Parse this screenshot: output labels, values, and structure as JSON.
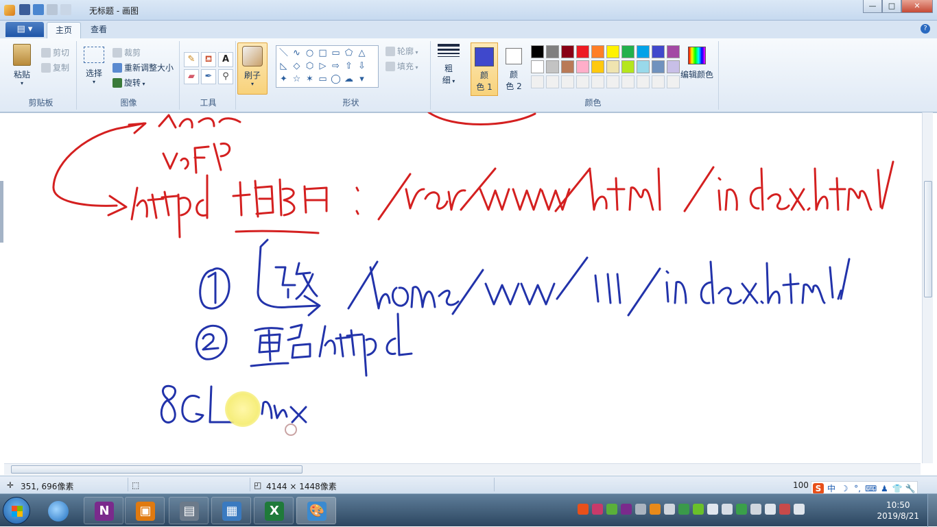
{
  "window": {
    "title": "无标题 - 画图",
    "controls": {
      "minimize": "—",
      "maximize": "□",
      "close": "✕"
    }
  },
  "tabs": {
    "app_menu": "▤ ▾",
    "home": "主页",
    "view": "查看",
    "help": "?"
  },
  "ribbon": {
    "clipboard": {
      "label": "剪贴板",
      "paste": "粘贴",
      "cut": "剪切",
      "copy": "复制"
    },
    "image": {
      "label": "图像",
      "select": "选择",
      "crop": "裁剪",
      "resize": "重新调整大小",
      "rotate": "旋转"
    },
    "tools": {
      "label": "工具",
      "text_tool": "A"
    },
    "brushes": {
      "label": "刷子"
    },
    "shapes": {
      "label": "形状",
      "glyphs": [
        "＼",
        "∿",
        "○",
        "□",
        "▭",
        "⬠",
        "△",
        "◺",
        "◇",
        "⬡",
        "▷",
        "⇨",
        "⇧",
        "⇩",
        "✦",
        "☆",
        "✶",
        "▭",
        "◯",
        "☁",
        "▾"
      ],
      "outline": "轮廓",
      "fill": "填充"
    },
    "size": {
      "label_top": "粗",
      "label_bottom": "细"
    },
    "colors": {
      "label": "颜色",
      "color1": "颜\n色 1",
      "color1_a": "颜",
      "color1_b": "色 1",
      "color2_a": "颜",
      "color2_b": "色 2",
      "edit_colors": "编辑颜色",
      "color1_hex": "#3f48cc",
      "color2_hex": "#ffffff",
      "palette": [
        "#000000",
        "#7f7f7f",
        "#880015",
        "#ed1c24",
        "#ff7f27",
        "#fff200",
        "#22b14c",
        "#00a2e8",
        "#3f48cc",
        "#a349a4",
        "#ffffff",
        "#c3c3c3",
        "#b97a57",
        "#ffaec9",
        "#ffc90e",
        "#efe4b0",
        "#b5e61d",
        "#99d9ea",
        "#7092be",
        "#c8bfe7",
        "#f0f0f0",
        "#f0f0f0",
        "#f0f0f0",
        "#f0f0f0",
        "#f0f0f0",
        "#f0f0f0",
        "#f0f0f0",
        "#f0f0f0",
        "#f0f0f0",
        "#f0f0f0"
      ]
    }
  },
  "statusbar": {
    "cursor_pos": "351, 696像素",
    "canvas_size": "4144 × 1448像素",
    "zoom": "100"
  },
  "ime": {
    "logo": "S",
    "lang": "中",
    "items": [
      "☽",
      "°,",
      "⌨",
      "♟",
      "👕",
      "🔧"
    ]
  },
  "taskbar": {
    "apps": [
      {
        "name": "onenote",
        "glyph": "N",
        "color": "#7a2a8c"
      },
      {
        "name": "vmware",
        "glyph": "▣",
        "color": "#e07a10"
      },
      {
        "name": "remote",
        "glyph": "▤",
        "color": "#6c7a8a"
      },
      {
        "name": "network",
        "glyph": "▦",
        "color": "#3a7ac0"
      },
      {
        "name": "excel",
        "glyph": "X",
        "color": "#1f7a3a"
      },
      {
        "name": "paint",
        "glyph": "🎨",
        "color": "#3a8ad0"
      }
    ],
    "time": "10:50",
    "date": "2019/8/21"
  }
}
